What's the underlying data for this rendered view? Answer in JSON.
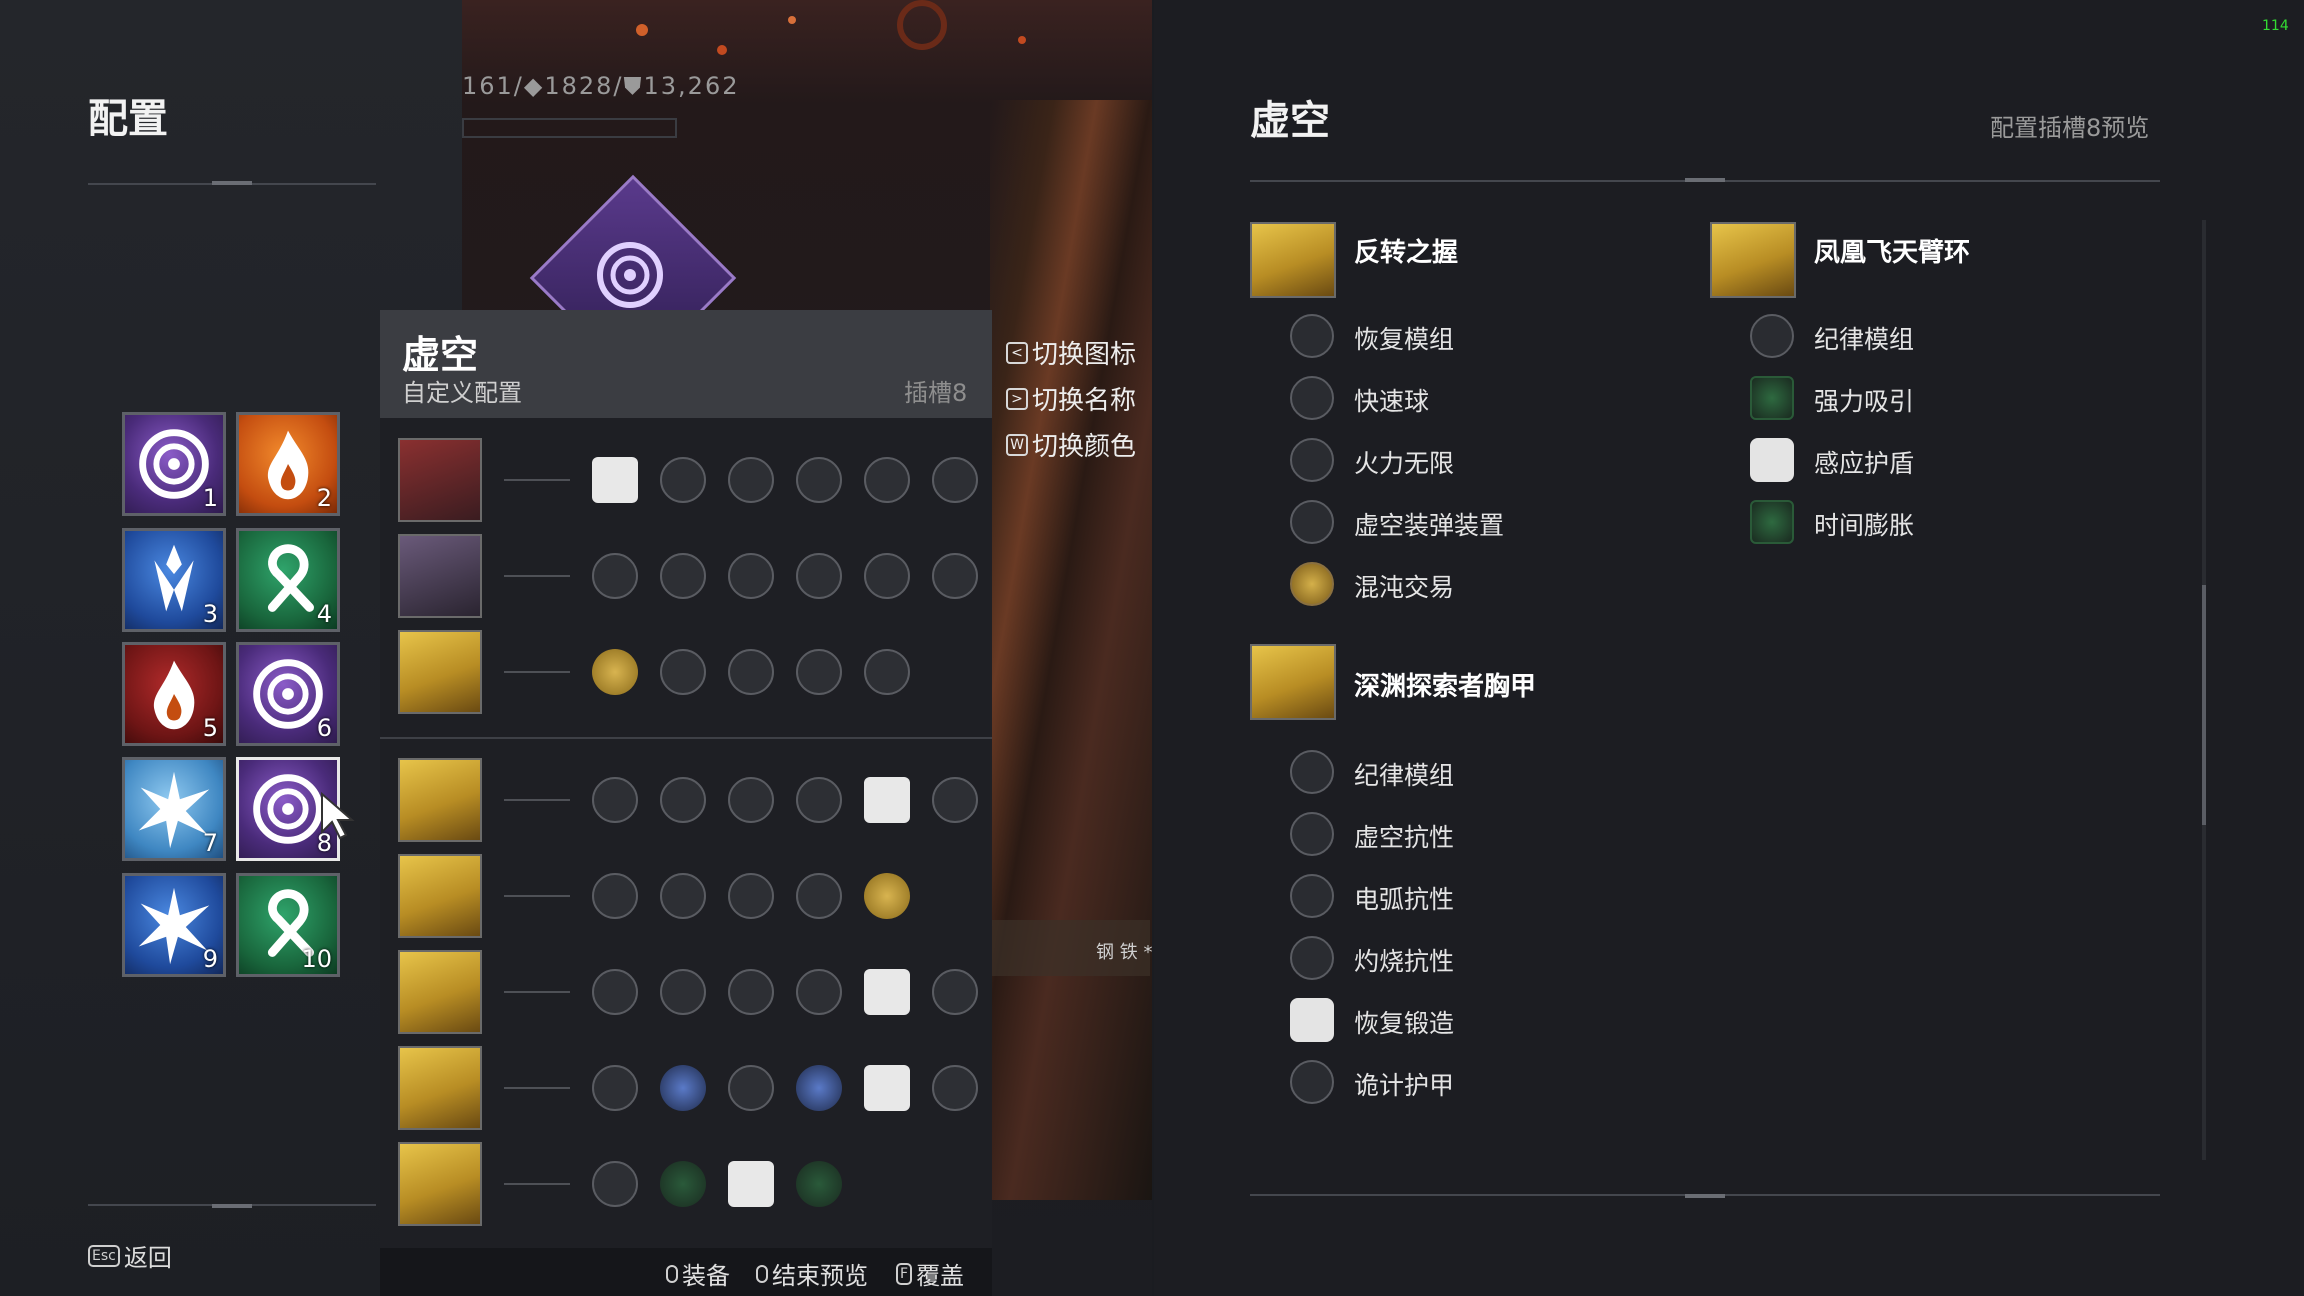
{
  "left": {
    "title": "配置",
    "esc_key": "Esc",
    "back_label": "返回",
    "loadouts": [
      {
        "num": "1",
        "type": "void",
        "icon": "void-swirl-icon"
      },
      {
        "num": "2",
        "type": "solar",
        "icon": "solar-flame-icon"
      },
      {
        "num": "3",
        "type": "arc",
        "icon": "arc-shard-icon"
      },
      {
        "num": "4",
        "type": "strand",
        "icon": "strand-knot-icon"
      },
      {
        "num": "5",
        "type": "solar-dark",
        "icon": "solar-flame-icon"
      },
      {
        "num": "6",
        "type": "void",
        "icon": "void-swirl-icon"
      },
      {
        "num": "7",
        "type": "arc-light",
        "icon": "arc-burst-icon"
      },
      {
        "num": "8",
        "type": "void",
        "icon": "void-swirl-icon",
        "selected": true
      },
      {
        "num": "9",
        "type": "arc",
        "icon": "arc-burst-icon"
      },
      {
        "num": "10",
        "type": "strand",
        "icon": "strand-knot-icon"
      }
    ]
  },
  "center": {
    "stats": "161/◆1828/⛊13,262",
    "side_text": "钢 铁 *"
  },
  "card": {
    "title": "虚空",
    "subtitle": "自定义配置",
    "slot": "插槽8",
    "options": [
      {
        "key": "<",
        "label": "切换图标"
      },
      {
        "key": ">",
        "label": "切换名称"
      },
      {
        "key": "W",
        "label": "切换颜色"
      }
    ],
    "footer": {
      "equip": "装备",
      "end_preview": "结束预览",
      "f_key": "F",
      "overwrite": "覆盖"
    },
    "rows": [
      {
        "thumb": "weapon",
        "perks": [
          "white",
          "circle",
          "circle",
          "circle",
          "circle",
          "circle"
        ]
      },
      {
        "thumb": "weapon2",
        "perks": [
          "circle",
          "circle",
          "circle",
          "circle",
          "circle",
          "circle"
        ]
      },
      {
        "thumb": "gold",
        "perks": [
          "gold",
          "circle",
          "circle",
          "circle",
          "circle"
        ]
      },
      {
        "thumb": "gold",
        "perks": [
          "hex",
          "circle",
          "circle",
          "circle",
          "white",
          "circle"
        ]
      },
      {
        "thumb": "gold",
        "perks": [
          "hex",
          "circle",
          "circle",
          "circle",
          "gold"
        ]
      },
      {
        "thumb": "gold",
        "perks": [
          "hex",
          "circle",
          "circle",
          "circle",
          "white",
          "circle"
        ]
      },
      {
        "thumb": "gold",
        "perks": [
          "hex",
          "blue",
          "circle",
          "blue",
          "white",
          "circle"
        ]
      },
      {
        "thumb": "gold",
        "perks": [
          "hex",
          "green",
          "white",
          "green"
        ]
      }
    ]
  },
  "right": {
    "title": "虚空",
    "subtitle": "配置插槽8预览",
    "fps": "114",
    "armor_sections": [
      {
        "name": "反转之握",
        "mods": [
          {
            "label": "恢复模组",
            "style": "circle"
          },
          {
            "label": "快速球",
            "style": "circle"
          },
          {
            "label": "火力无限",
            "style": "circle"
          },
          {
            "label": "虚空装弹装置",
            "style": "circle"
          },
          {
            "label": "混沌交易",
            "style": "gold"
          }
        ]
      },
      {
        "name": "凤凰飞天臂环",
        "mods": [
          {
            "label": "纪律模组",
            "style": "circle"
          },
          {
            "label": "强力吸引",
            "style": "green"
          },
          {
            "label": "感应护盾",
            "style": "white"
          },
          {
            "label": "时间膨胀",
            "style": "green"
          }
        ]
      },
      {
        "name": "深渊探索者胸甲",
        "mods": [
          {
            "label": "纪律模组",
            "style": "circle"
          },
          {
            "label": "虚空抗性",
            "style": "circle"
          },
          {
            "label": "电弧抗性",
            "style": "circle"
          },
          {
            "label": "灼烧抗性",
            "style": "circle"
          },
          {
            "label": "恢复锻造",
            "style": "white"
          },
          {
            "label": "诡计护甲",
            "style": "circle"
          }
        ]
      }
    ]
  }
}
